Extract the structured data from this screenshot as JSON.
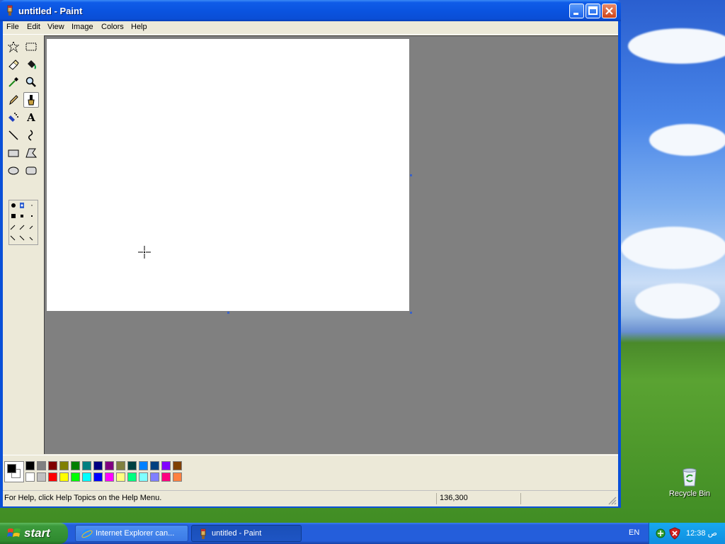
{
  "window": {
    "title": "untitled - Paint",
    "buttons": {
      "minimize": "minimize",
      "maximize": "maximize",
      "close": "close"
    }
  },
  "menubar": {
    "items": [
      "File",
      "Edit",
      "View",
      "Image",
      "Colors",
      "Help"
    ]
  },
  "toolbox": {
    "tools": [
      {
        "name": "free-form-select-tool",
        "glyph": "✧"
      },
      {
        "name": "select-tool",
        "glyph": "⬚"
      },
      {
        "name": "eraser-tool",
        "glyph": "⌫"
      },
      {
        "name": "fill-tool",
        "glyph": "◆"
      },
      {
        "name": "pick-color-tool",
        "glyph": "⟋"
      },
      {
        "name": "magnifier-tool",
        "glyph": "🔍"
      },
      {
        "name": "pencil-tool",
        "glyph": "✎"
      },
      {
        "name": "brush-tool",
        "glyph": "♙"
      },
      {
        "name": "airbrush-tool",
        "glyph": "✱"
      },
      {
        "name": "text-tool",
        "glyph": "A"
      },
      {
        "name": "line-tool",
        "glyph": "╲"
      },
      {
        "name": "curve-tool",
        "glyph": "∫"
      },
      {
        "name": "rectangle-tool",
        "glyph": "▭"
      },
      {
        "name": "polygon-tool",
        "glyph": "⏢"
      },
      {
        "name": "ellipse-tool",
        "glyph": "⬭"
      },
      {
        "name": "rounded-rectangle-tool",
        "glyph": "▢"
      }
    ],
    "active_tool": "brush-tool"
  },
  "palette": {
    "foreground": "#000000",
    "background": "#ffffff",
    "colors_top": [
      "#000000",
      "#808080",
      "#800000",
      "#808000",
      "#008000",
      "#008080",
      "#000080",
      "#800080",
      "#808040",
      "#004040",
      "#0080ff",
      "#004080",
      "#8000ff",
      "#804000"
    ],
    "colors_bottom": [
      "#ffffff",
      "#c0c0c0",
      "#ff0000",
      "#ffff00",
      "#00ff00",
      "#00ffff",
      "#0000ff",
      "#ff00ff",
      "#ffff80",
      "#00ff80",
      "#80ffff",
      "#8080ff",
      "#ff0080",
      "#ff8040"
    ]
  },
  "statusbar": {
    "help_text": "For Help, click Help Topics on the Help Menu.",
    "coordinates": "136,300"
  },
  "desktop": {
    "recycle_bin_label": "Recycle Bin"
  },
  "taskbar": {
    "start_label": "start",
    "tasks": [
      {
        "label": "Internet Explorer can..."
      },
      {
        "label": "untitled - Paint"
      }
    ],
    "tray": {
      "language": "EN",
      "clock": "12:38 ص"
    }
  }
}
